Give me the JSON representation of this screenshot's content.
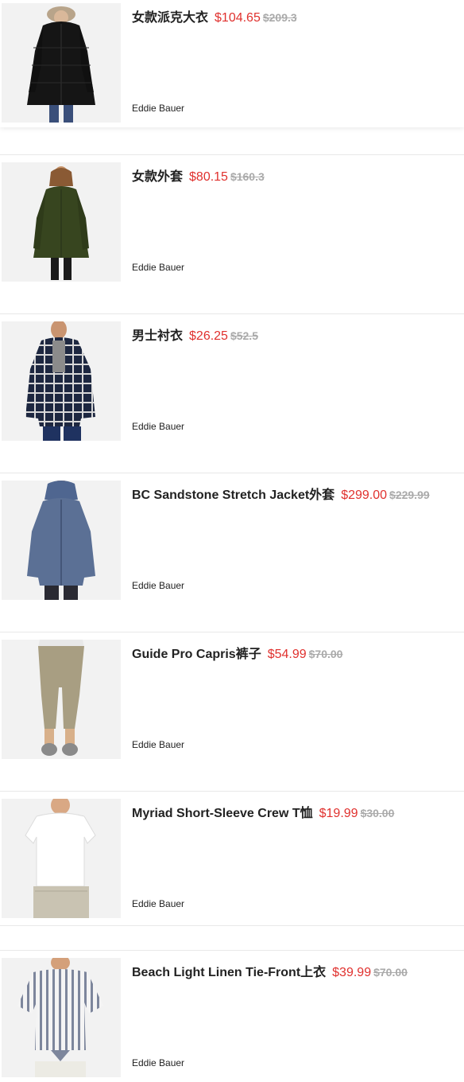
{
  "products": [
    {
      "title": "女款派克大衣",
      "price": "$104.65",
      "original_price": "$209.3",
      "brand": "Eddie Bauer",
      "image": "black-parka-photo"
    },
    {
      "title": "女款外套",
      "price": "$80.15",
      "original_price": "$160.3",
      "brand": "Eddie Bauer",
      "image": "green-coat-photo"
    },
    {
      "title": "男士衬衣",
      "price": "$26.25",
      "original_price": "$52.5",
      "brand": "Eddie Bauer",
      "image": "plaid-shirt-photo"
    },
    {
      "title": "BC Sandstone Stretch Jacket外套",
      "price": "$299.00",
      "original_price": "$229.99",
      "brand": "Eddie Bauer",
      "image": "blue-jacket-photo"
    },
    {
      "title": "Guide Pro Capris裤子",
      "price": "$54.99",
      "original_price": "$70.00",
      "brand": "Eddie Bauer",
      "image": "khaki-capris-photo"
    },
    {
      "title": "Myriad Short-Sleeve Crew T恤",
      "price": "$19.99",
      "original_price": "$30.00",
      "brand": "Eddie Bauer",
      "image": "white-tshirt-photo"
    },
    {
      "title": "Beach Light Linen Tie-Front上衣",
      "price": "$39.99",
      "original_price": "$70.00",
      "brand": "Eddie Bauer",
      "image": "striped-top-photo"
    }
  ],
  "colors": {
    "price": "#e0312e",
    "original_price": "#aaaaaa",
    "divider": "#e8e8e8",
    "thumb_bg": "#f2f2f2"
  }
}
